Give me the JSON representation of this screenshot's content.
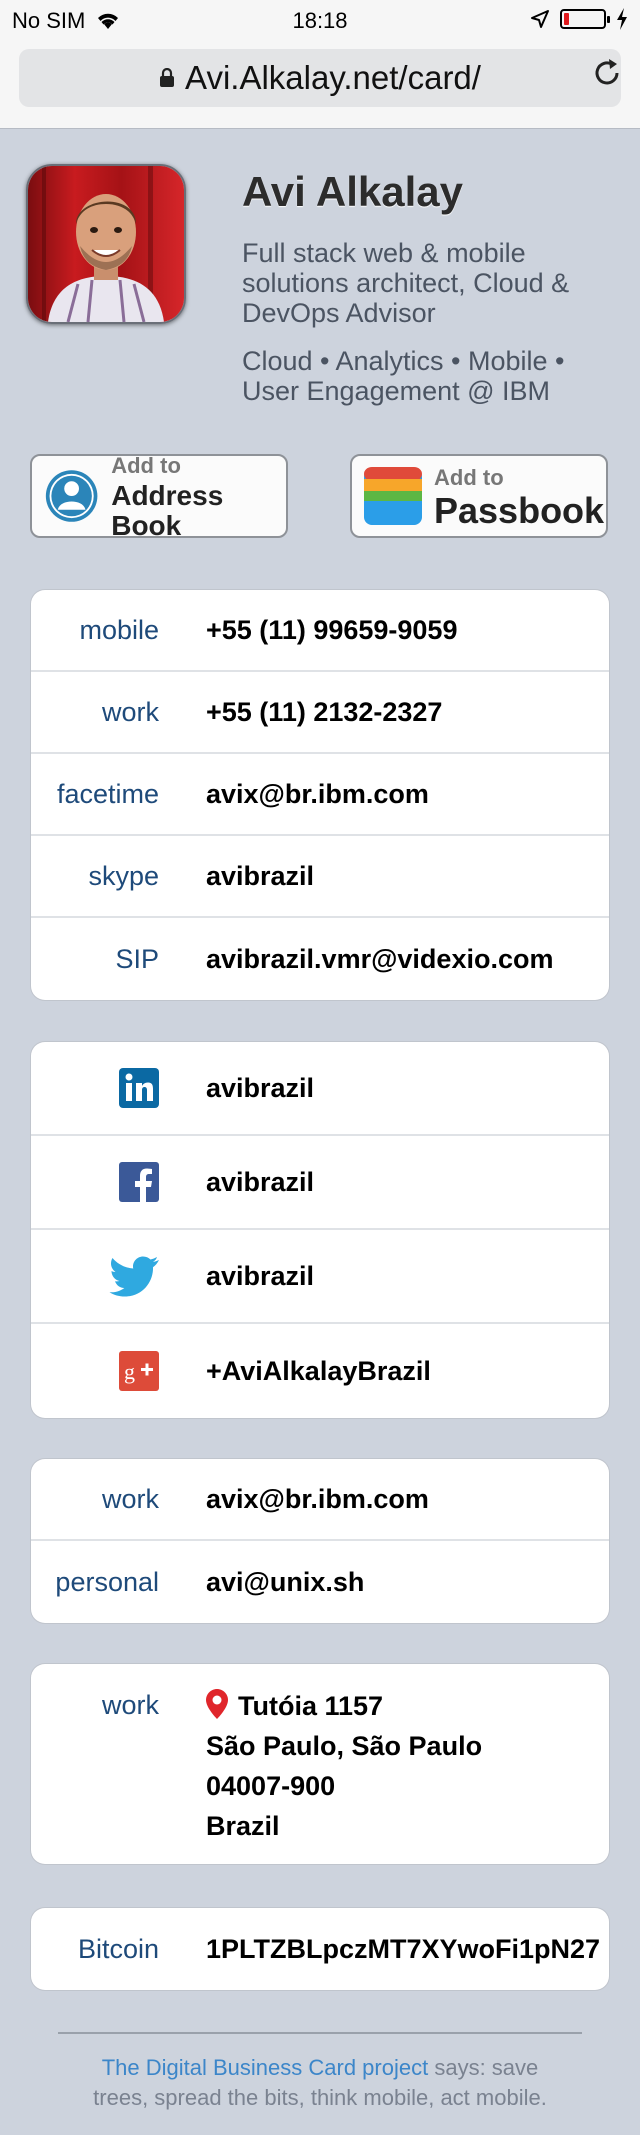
{
  "status": {
    "carrier": "No SIM",
    "time": "18:18"
  },
  "browser": {
    "url": "Avi.Alkalay.net/card/"
  },
  "profile": {
    "name": "Avi Alkalay",
    "tagline": "Full stack web & mobile solutions architect, Cloud & DevOps Advisor",
    "tagline2": "Cloud • Analytics • Mobile • User Engagement @ IBM"
  },
  "buttons": {
    "address_book": {
      "small": "Add to",
      "big": "Address Book"
    },
    "passbook": {
      "small": "Add to",
      "big": "Passbook"
    }
  },
  "phones": [
    {
      "label": "mobile",
      "value": "+55 (11) 99659-9059"
    },
    {
      "label": "work",
      "value": "+55 (11) 2132-2327"
    },
    {
      "label": "facetime",
      "value": "avix@br.ibm.com"
    },
    {
      "label": "skype",
      "value": "avibrazil"
    },
    {
      "label": "SIP",
      "value": "avibrazil.vmr@videxio.com"
    }
  ],
  "social": [
    {
      "icon": "linkedin-icon",
      "value": "avibrazil"
    },
    {
      "icon": "facebook-icon",
      "value": "avibrazil"
    },
    {
      "icon": "twitter-icon",
      "value": "avibrazil"
    },
    {
      "icon": "googleplus-icon",
      "value": "+AviAlkalayBrazil"
    }
  ],
  "emails": [
    {
      "label": "work",
      "value": "avix@br.ibm.com"
    },
    {
      "label": "personal",
      "value": "avi@unix.sh"
    }
  ],
  "address": {
    "label": "work",
    "line1": "Tutóia 1157",
    "line2": "São Paulo, São Paulo",
    "line3": "04007-900",
    "line4": "Brazil"
  },
  "bitcoin": {
    "label": "Bitcoin",
    "value": "1PLTZBLpczMT7XYwoFi1pN27"
  },
  "footer": {
    "link": "The Digital Business Card project",
    "text1": " says: save",
    "text2": "trees, spread the bits, think mobile, act mobile."
  },
  "colors": {
    "background": "#cdd3dd",
    "label": "#1e4a7a",
    "link": "#3c86c9"
  }
}
